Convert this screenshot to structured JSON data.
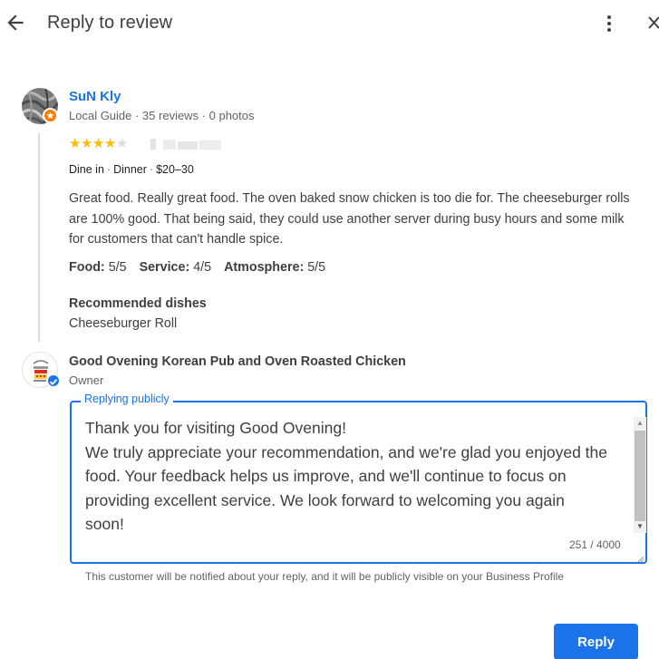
{
  "header": {
    "title": "Reply to review",
    "icons": {
      "back": "arrow-left-icon",
      "more": "more-vert-icon",
      "close": "close-icon"
    }
  },
  "review": {
    "reviewer_name": "SuN Kly",
    "reviewer_meta": "Local Guide · 35 reviews · 0 photos",
    "rating": 4,
    "rating_max": 5,
    "dine_type": "Dine in",
    "meal": "Dinner",
    "price": "$20–30",
    "text": "Great food. Really great food. The oven baked snow chicken is too die for. The cheeseburger rolls are 100% good. That being said, they could use another server during busy hours and some milk for customers that can't handle spice.",
    "ratings": {
      "food_label": "Food:",
      "food_value": "5/5",
      "service_label": "Service:",
      "service_value": "4/5",
      "atmosphere_label": "Atmosphere:",
      "atmosphere_value": "5/5"
    },
    "recommended_title": "Recommended dishes",
    "recommended_item": "Cheeseburger Roll"
  },
  "owner": {
    "name": "Good Ovening Korean Pub and Oven Roasted Chicken",
    "role": "Owner"
  },
  "reply": {
    "legend": "Replying publicly",
    "text": "Thank you for visiting Good Ovening!\nWe truly appreciate your recommendation, and we're glad you enjoyed the\nfood. Your feedback helps us improve, and we'll continue to focus on\nproviding excellent service. We look forward to welcoming you again\nsoon!",
    "char_count": "251 / 4000",
    "notice": "This customer will be notified about your reply, and it will be publicly visible on your Business Profile",
    "button_label": "Reply"
  },
  "colors": {
    "accent": "#1a73e8",
    "star": "#fbbc04",
    "guide_badge": "#f57c00"
  }
}
